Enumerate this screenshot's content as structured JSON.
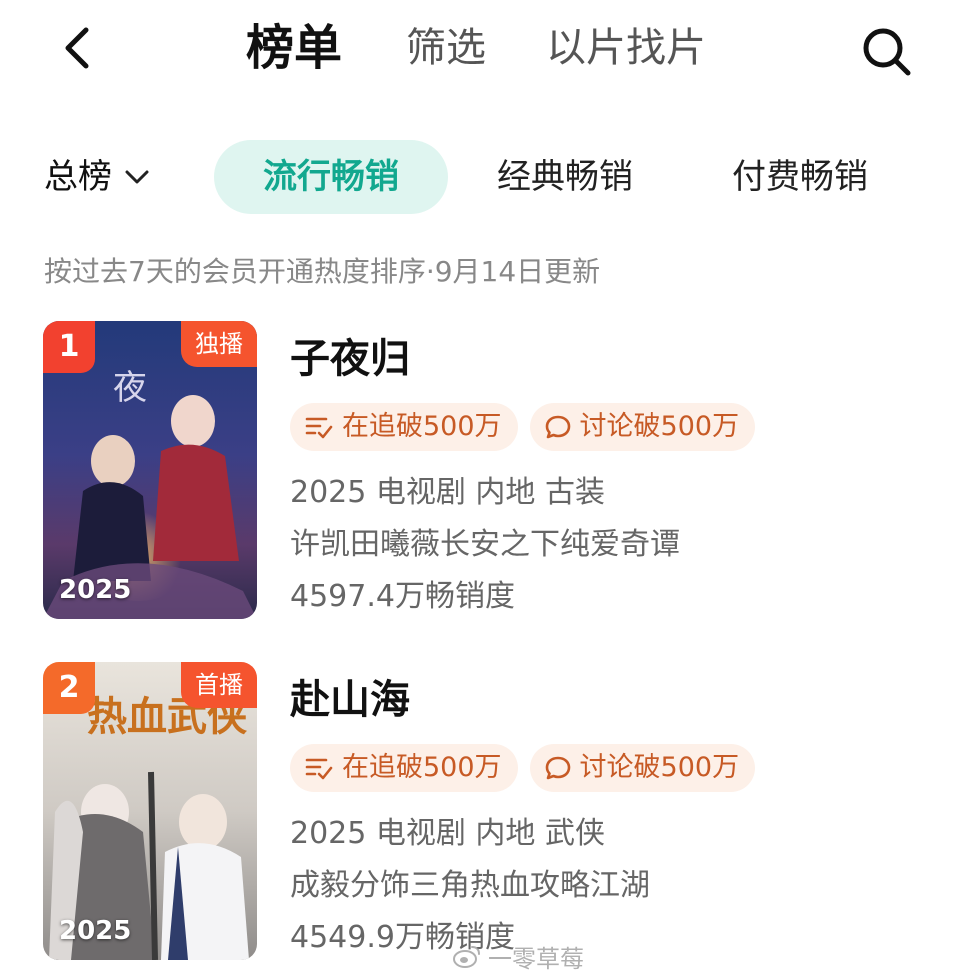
{
  "header": {
    "back_icon": "chevron-left-icon",
    "tabs": [
      {
        "label": "榜单",
        "active": true
      },
      {
        "label": "筛选",
        "active": false
      },
      {
        "label": "以片找片",
        "active": false
      }
    ],
    "search_icon": "search-icon"
  },
  "categories": {
    "dropdown_label": "总榜",
    "dropdown_icon": "chevron-down-icon",
    "pills": [
      {
        "label": "流行畅销",
        "active": true
      },
      {
        "label": "经典畅销",
        "active": false
      },
      {
        "label": "付费畅销",
        "active": false
      }
    ]
  },
  "subtitle": "按过去7天的会员开通热度排序·9月14日更新",
  "items": [
    {
      "rank": "1",
      "badge": "独播",
      "poster_year": "2025",
      "title": "子夜归",
      "chips": [
        {
          "icon": "follow-list-icon",
          "label": "在追破500万"
        },
        {
          "icon": "chat-bubble-icon",
          "label": "讨论破500万"
        }
      ],
      "meta": "2025 电视剧 内地 古装",
      "description": "许凯田曦薇长安之下纯爱奇谭",
      "sales": "4597.4万畅销度"
    },
    {
      "rank": "2",
      "badge": "首播",
      "poster_year": "2025",
      "title": "赴山海",
      "chips": [
        {
          "icon": "follow-list-icon",
          "label": "在追破500万"
        },
        {
          "icon": "chat-bubble-icon",
          "label": "讨论破500万"
        }
      ],
      "meta": "2025 电视剧 内地 武侠",
      "description": "成毅分饰三角热血攻略江湖",
      "sales": "4549.9万畅销度"
    }
  ],
  "watermark": "一零草莓",
  "colors": {
    "accent": "#12a88f",
    "accent_bg": "#dff5f0",
    "chip_bg": "#fdf0e8",
    "chip_text": "#c75a25",
    "rank_red": "#f2412f",
    "badge_orange": "#f5542e"
  }
}
